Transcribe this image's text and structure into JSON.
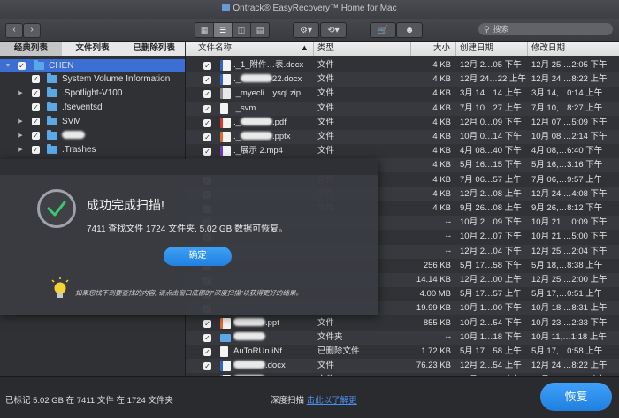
{
  "window": {
    "title": "Ontrack® EasyRecovery™ Home for Mac"
  },
  "toolbar": {
    "back_icon": "chevron-left-icon",
    "forward_icon": "chevron-right-icon",
    "search_placeholder": "搜索"
  },
  "sidebar": {
    "tabs": [
      "经典列表",
      "文件列表",
      "已删除列表"
    ],
    "active_tab": 0,
    "items": [
      {
        "label": "CHEN",
        "indent": 0,
        "expanded": true,
        "selected": true
      },
      {
        "label": "System Volume Information",
        "indent": 1
      },
      {
        "label": ".Spotlight-V100",
        "indent": 1,
        "arrow": true
      },
      {
        "label": ".fseventsd",
        "indent": 1
      },
      {
        "label": "SVM",
        "indent": 1,
        "arrow": true
      },
      {
        "label": "",
        "indent": 1,
        "arrow": true,
        "redacted": true
      },
      {
        "label": ".Trashes",
        "indent": 1,
        "arrow": true
      }
    ]
  },
  "columns": {
    "name": "文件名称",
    "type": "类型",
    "size": "大小",
    "created": "创建日期",
    "modified": "修改日期"
  },
  "files": [
    {
      "name": "._1_附件…表.docx",
      "icon": "doc",
      "type": "文件",
      "size": "4 KB",
      "created": "12月 2…05 下午",
      "modified": "12月 25,…2:05 下午"
    },
    {
      "name": "._…22.docx",
      "icon": "doc",
      "type": "文件",
      "size": "4 KB",
      "created": "12月 24…22 上午",
      "modified": "12月 24,…8:22 上午",
      "redacted": true
    },
    {
      "name": "._myecli…ysql.zip",
      "icon": "zip",
      "type": "文件",
      "size": "4 KB",
      "created": "3月 14…14 上午",
      "modified": "3月 14,…0:14 上午"
    },
    {
      "name": "._svm",
      "icon": "blank",
      "type": "文件",
      "size": "4 KB",
      "created": "7月 10…27 上午",
      "modified": "7月 10,…8:27 上午"
    },
    {
      "name": "._….pdf",
      "icon": "pdf",
      "type": "文件",
      "size": "4 KB",
      "created": "12月 0…09 下午",
      "modified": "12月 07,…5:09 下午",
      "redacted": true
    },
    {
      "name": "._….pptx",
      "icon": "ppt",
      "type": "文件",
      "size": "4 KB",
      "created": "10月 0…14 下午",
      "modified": "10月 08,…2:14 下午",
      "redacted": true
    },
    {
      "name": "._展示 2.mp4",
      "icon": "vid",
      "type": "文件",
      "size": "4 KB",
      "created": "4月 08…40 下午",
      "modified": "4月 08,…6:40 下午"
    },
    {
      "name": "",
      "icon": "none",
      "type": "文件",
      "size": "4 KB",
      "created": "5月 16…15 下午",
      "modified": "5月 16,…3:16 下午"
    },
    {
      "name": "",
      "icon": "none",
      "type": "文件",
      "size": "4 KB",
      "created": "7月 06…57 上午",
      "modified": "7月 06,…9:57 上午"
    },
    {
      "name": "",
      "icon": "none",
      "type": "文件",
      "size": "4 KB",
      "created": "12月 2…08 上午",
      "modified": "12月 24,…4:08 下午"
    },
    {
      "name": "",
      "icon": "none",
      "type": "文件",
      "size": "4 KB",
      "created": "9月 26…08 上午",
      "modified": "9月 26,…8:12 下午"
    },
    {
      "name": "",
      "icon": "none",
      "type": "",
      "size": "--",
      "created": "10月 2…09 下午",
      "modified": "10月 21,…0:09 下午"
    },
    {
      "name": "",
      "icon": "none",
      "type": "",
      "size": "--",
      "created": "10月 2…07 下午",
      "modified": "10月 21,…5:00 下午"
    },
    {
      "name": "",
      "icon": "none",
      "type": "",
      "size": "--",
      "created": "12月 2…04 下午",
      "modified": "12月 25,…2:04 下午"
    },
    {
      "name": "",
      "icon": "none",
      "type": "",
      "size": "256 KB",
      "created": "5月 17…58 下午",
      "modified": "5月 18,…8:38 上午"
    },
    {
      "name": "",
      "icon": "none",
      "type": "",
      "size": "14.14 KB",
      "created": "12月 2…00 上午",
      "modified": "12月 25,…2:00 上午"
    },
    {
      "name": "",
      "icon": "none",
      "type": "",
      "size": "4.00 MB",
      "created": "5月 17…57 上午",
      "modified": "5月 17,…0:51 上午"
    },
    {
      "name": "",
      "icon": "none",
      "type": "",
      "size": "19.99 KB",
      "created": "10月 1…00 下午",
      "modified": "10月 18,…8:31 上午"
    },
    {
      "name": "….ppt",
      "icon": "ppt",
      "type": "文件",
      "size": "855 KB",
      "created": "10月 2…54 下午",
      "modified": "10月 23,…2:33 下午",
      "redacted": true
    },
    {
      "name": "",
      "icon": "folder",
      "type": "文件夹",
      "size": "--",
      "created": "10月 1…18 下午",
      "modified": "10月 11,…1:18 上午",
      "redacted": true
    },
    {
      "name": "AuToRUn.iNf",
      "icon": "blank",
      "type": "已删除文件",
      "size": "1.72 KB",
      "created": "5月 17…58 上午",
      "modified": "5月 17,…0:58 上午"
    },
    {
      "name": "….docx",
      "icon": "doc",
      "type": "文件",
      "size": "76.23 KB",
      "created": "12月 2…54 上午",
      "modified": "12月 24,…8:22 上午",
      "redacted": true
    },
    {
      "name": "",
      "icon": "doc",
      "type": "文件",
      "size": "84.10 KB",
      "created": "12月 2…22 上午",
      "modified": "12月 24,…8:22 上午",
      "redacted": true
    }
  ],
  "dialog": {
    "title": "成功完成扫描!",
    "message": "7411 查找文件 1724 文件夹. 5.02 GB 数据可恢复。",
    "ok": "确定",
    "tip": "如果您找不到要查找的内容, 请点击窗口底部的\"深度扫描\"以获得更好的结果。"
  },
  "status": {
    "left": "已标记 5.02 GB 在 7411 文件 在 1724 文件夹",
    "deep_scan": "深度扫描",
    "deep_scan_link": "击此以了解更",
    "recover": "恢复"
  },
  "colors": {
    "accent": "#2f8ef0",
    "selection": "#3b6fd4",
    "folder": "#5aa8e6"
  }
}
